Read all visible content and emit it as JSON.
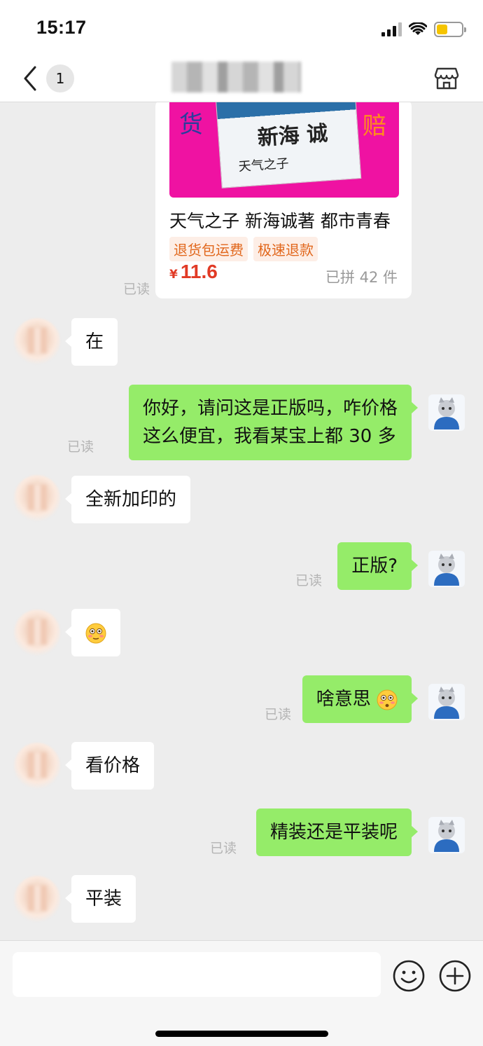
{
  "status_bar": {
    "time": "15:17"
  },
  "nav": {
    "unread_count": "1"
  },
  "product": {
    "cover_left_word": "货",
    "cover_right_word": "赔",
    "cover_author": "新海 诚",
    "cover_title": "天气之子",
    "name": "天气之子 新海诚著 都市青春",
    "tags": [
      "退货包运费",
      "极速退款"
    ],
    "currency": "¥",
    "price": "11.6",
    "sold": "已拼 42 件"
  },
  "read_label": "已读",
  "messages": [
    {
      "from": "them",
      "text": "在"
    },
    {
      "from": "me",
      "lines": [
        "你好，请问这是正版吗，咋价格",
        "这么便宜，我看某宝上都 30 多"
      ]
    },
    {
      "from": "them",
      "text": "全新加印的"
    },
    {
      "from": "me",
      "text": "正版?"
    },
    {
      "from": "them",
      "emoji": "flushed-face"
    },
    {
      "from": "me",
      "text": "啥意思",
      "emoji": "flushed-face"
    },
    {
      "from": "them",
      "text": "看价格"
    },
    {
      "from": "me",
      "text": "精装还是平装呢"
    },
    {
      "from": "them",
      "text": "平装"
    }
  ],
  "input": {
    "value": "",
    "placeholder": ""
  },
  "colors": {
    "chat_background": "#ededed",
    "my_bubble": "#95ec69",
    "their_bubble": "#ffffff",
    "price": "#e13a25",
    "tag_text": "#e1671c",
    "product_image": "#ef12a2"
  },
  "icons": [
    "back-chevron-icon",
    "shop-icon",
    "emoji-face-icon",
    "plus-circle-icon",
    "signal-icon",
    "wifi-icon",
    "battery-icon"
  ]
}
